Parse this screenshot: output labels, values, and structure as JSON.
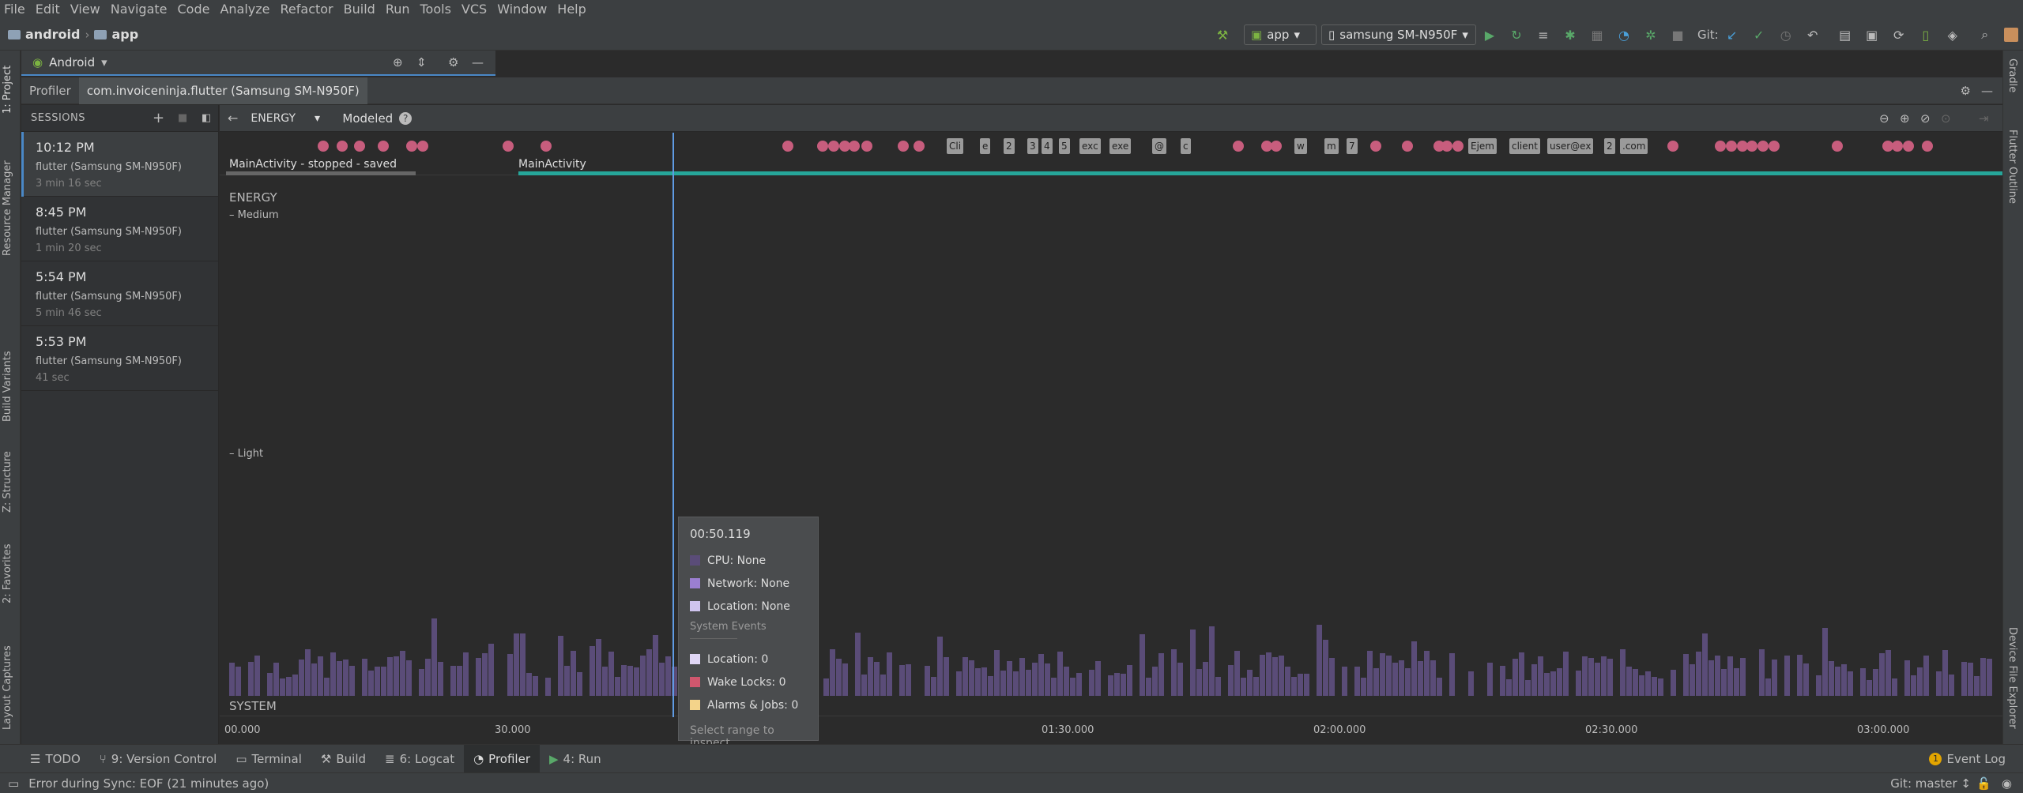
{
  "menu": [
    "File",
    "Edit",
    "View",
    "Navigate",
    "Code",
    "Analyze",
    "Refactor",
    "Build",
    "Run",
    "Tools",
    "VCS",
    "Window",
    "Help"
  ],
  "breadcrumb": {
    "project": "android",
    "module": "app"
  },
  "toolbar": {
    "run_config": "app",
    "device": "samsung SM-N950F",
    "git_label": "Git:"
  },
  "project_panel": {
    "view_mode": "Android"
  },
  "profiler_tabs": {
    "profiler": "Profiler",
    "process": "com.invoiceninja.flutter (Samsung SM-N950F)"
  },
  "left_tool_tabs": [
    "1: Project",
    "Resource Manager",
    "Build Variants",
    "Z: Structure",
    "2: Favorites",
    "Layout Captures"
  ],
  "right_tool_tabs": [
    "Gradle",
    "Flutter Outline",
    "Device File Explorer"
  ],
  "sessions": {
    "header": "SESSIONS",
    "items": [
      {
        "time": "10:12 PM",
        "device": "flutter (Samsung SM-N950F)",
        "duration": "3 min 16 sec"
      },
      {
        "time": "8:45 PM",
        "device": "flutter (Samsung SM-N950F)",
        "duration": "1 min 20 sec"
      },
      {
        "time": "5:54 PM",
        "device": "flutter (Samsung SM-N950F)",
        "duration": "5 min 46 sec"
      },
      {
        "time": "5:53 PM",
        "device": "flutter (Samsung SM-N950F)",
        "duration": "41 sec"
      }
    ]
  },
  "profiler": {
    "monitor": "ENERGY",
    "mode": "Modeled",
    "activities": {
      "first": "MainActivity - stopped - saved",
      "second": "MainActivity"
    },
    "key_events": [
      "Cli",
      "e",
      "2",
      "3",
      "4",
      "5",
      "exc",
      "exe",
      "@",
      "c",
      "w",
      "m",
      "7",
      "Ejem",
      "client",
      "user@ex",
      "2",
      ".com"
    ],
    "section_label": "ENERGY",
    "levels": {
      "medium": "Medium",
      "light": "Light"
    },
    "system_label": "SYSTEM",
    "axis_ticks": [
      "00.000",
      "30.000",
      "01:30.000",
      "02:00.000",
      "02:30.000",
      "03:00.000"
    ],
    "colors": {
      "event_dot": "#c75d7d",
      "bar": "#5a4c78",
      "activity_line": "#26a69a",
      "cursor": "#5f9be3"
    }
  },
  "tooltip": {
    "time": "00:50.119",
    "cpu": "CPU: None",
    "network": "Network: None",
    "location": "Location: None",
    "system_events": "System Events",
    "sys_location": "Location: 0",
    "wake_locks": "Wake Locks: 0",
    "alarms": "Alarms & Jobs: 0",
    "hint": "Select range to inspect",
    "colors": {
      "cpu": "#5a4c78",
      "network": "#9b7fd1",
      "location": "#cfc4ee",
      "sys_location": "#e0d6f5",
      "wake": "#d0576e",
      "alarms": "#f3d38a"
    }
  },
  "bottom_tabs": [
    {
      "label": "TODO",
      "icon": "list-icon"
    },
    {
      "label": "9: Version Control",
      "icon": "branch-icon"
    },
    {
      "label": "Terminal",
      "icon": "terminal-icon"
    },
    {
      "label": "Build",
      "icon": "hammer-icon"
    },
    {
      "label": "6: Logcat",
      "icon": "logcat-icon"
    },
    {
      "label": "Profiler",
      "icon": "gauge-icon"
    },
    {
      "label": "4: Run",
      "icon": "play-icon"
    }
  ],
  "event_log": "Event Log",
  "event_log_count": "1",
  "status": {
    "message": "Error during Sync: EOF (21 minutes ago)",
    "branch": "Git: master ↕"
  }
}
